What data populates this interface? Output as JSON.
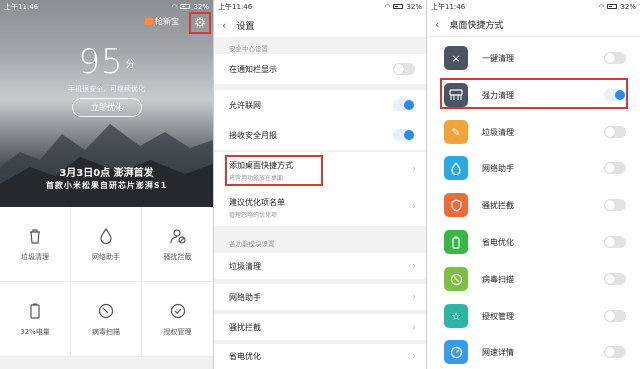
{
  "status_bar": {
    "time": "上午11:46",
    "battery": "32%"
  },
  "colors": {
    "accent": "#2a8ce8",
    "highlight": "#d23a3a"
  },
  "home": {
    "deep_speed": "抢新宝",
    "score": "95",
    "score_unit": "分",
    "hint": "手机很安全，可继续优化",
    "optimize_button": "立即优化",
    "promo_line1": "3月3日0点 澎湃首发",
    "promo_line2": "首款小米松果自研芯片澎湃S1",
    "tools": [
      {
        "label": "垃圾清理",
        "icon": "trash-icon"
      },
      {
        "label": "网络助手",
        "icon": "drop-icon"
      },
      {
        "label": "骚扰拦截",
        "icon": "block-user-icon"
      },
      {
        "label": "32%电量",
        "icon": "battery-icon"
      },
      {
        "label": "病毒扫描",
        "icon": "scan-icon"
      },
      {
        "label": "授权管理",
        "icon": "check-circle-icon"
      }
    ]
  },
  "settings": {
    "title": "设置",
    "section1": "安全中心设置",
    "rows": [
      {
        "label": "在通知栏显示",
        "toggle": false
      },
      {
        "label": "允许联网",
        "toggle": true
      },
      {
        "label": "接收安全月报",
        "toggle": true
      },
      {
        "label": "添加桌面快捷方式",
        "sub": "将常用功能放在桌面"
      },
      {
        "label": "建议优化项名单",
        "sub": "管理忽略的优化项"
      }
    ],
    "section2": "各功能模块设置",
    "modules": [
      "垃圾清理",
      "网络助手",
      "骚扰拦截",
      "省电优化"
    ]
  },
  "shortcuts": {
    "title": "桌面快捷方式",
    "items": [
      {
        "label": "一键清理",
        "icon": "close-icon",
        "color": "#4a5462",
        "toggle": false
      },
      {
        "label": "强力清理",
        "icon": "broom-icon",
        "color": "#4a5462",
        "toggle": true
      },
      {
        "label": "垃圾清理",
        "icon": "brush-icon",
        "color": "#f2a23a",
        "toggle": false
      },
      {
        "label": "网络助手",
        "icon": "drop-icon",
        "color": "#2aa8e0",
        "toggle": false
      },
      {
        "label": "骚扰拦截",
        "icon": "shield-icon",
        "color": "#ef6a3a",
        "toggle": false
      },
      {
        "label": "省电优化",
        "icon": "battery-icon",
        "color": "#39b54a",
        "toggle": false
      },
      {
        "label": "病毒扫描",
        "icon": "scan-icon",
        "color": "#7bc043",
        "toggle": false
      },
      {
        "label": "授权管理",
        "icon": "star-icon",
        "color": "#2cb6a3",
        "toggle": false
      },
      {
        "label": "网速详情",
        "icon": "speed-icon",
        "color": "#3a9be8",
        "toggle": false
      }
    ]
  }
}
